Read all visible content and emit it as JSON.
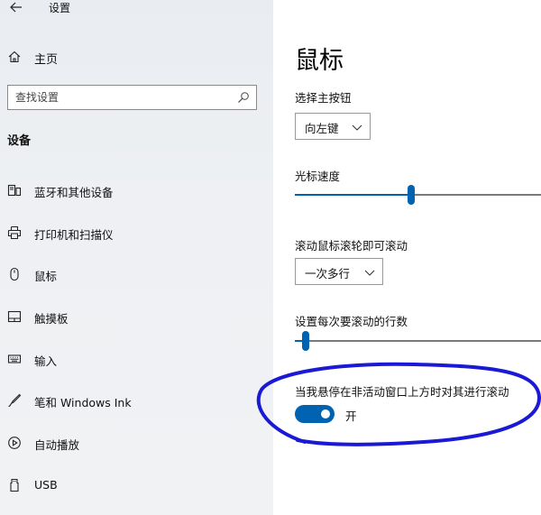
{
  "window": {
    "title": "设置"
  },
  "sidebar": {
    "home_label": "主页",
    "search_placeholder": "查找设置",
    "section_title": "设备",
    "items": [
      {
        "label": "蓝牙和其他设备",
        "icon": "bluetooth-devices-icon"
      },
      {
        "label": "打印机和扫描仪",
        "icon": "printer-icon"
      },
      {
        "label": "鼠标",
        "icon": "mouse-icon"
      },
      {
        "label": "触摸板",
        "icon": "touchpad-icon"
      },
      {
        "label": "输入",
        "icon": "keyboard-icon"
      },
      {
        "label": "笔和 Windows Ink",
        "icon": "pen-icon"
      },
      {
        "label": "自动播放",
        "icon": "autoplay-icon"
      },
      {
        "label": "USB",
        "icon": "usb-icon"
      }
    ]
  },
  "main": {
    "title": "鼠标",
    "primary_button": {
      "label": "选择主按钮",
      "value": "向左键"
    },
    "cursor_speed": {
      "label": "光标速度",
      "value_fraction": 0.47
    },
    "scroll_wheel": {
      "label": "滚动鼠标滚轮即可滚动",
      "value": "一次多行"
    },
    "lines_per_scroll": {
      "label": "设置每次要滚动的行数",
      "value_fraction": 0.03
    },
    "inactive_scroll": {
      "label": "当我悬停在非活动窗口上方时对其进行滚动",
      "state": "开",
      "on": true
    }
  },
  "colors": {
    "accent": "#0063b1",
    "sidebar_bg": "#eef0f3",
    "annotation_stroke": "#1a1ad6"
  }
}
